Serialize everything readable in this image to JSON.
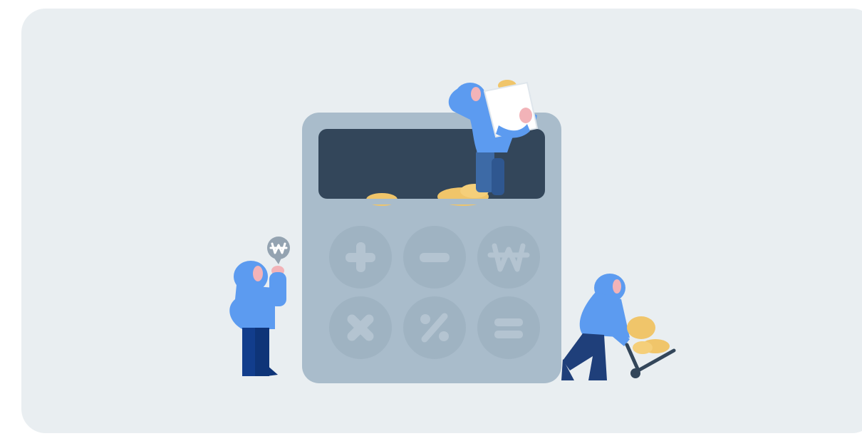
{
  "illustration": {
    "subject": "calculator",
    "keys": [
      {
        "symbol": "+",
        "icon": "plus-icon"
      },
      {
        "symbol": "−",
        "icon": "minus-icon"
      },
      {
        "symbol": "₩",
        "icon": "won-icon"
      },
      {
        "symbol": "×",
        "icon": "times-icon"
      },
      {
        "symbol": "%",
        "icon": "percent-icon"
      },
      {
        "symbol": "=",
        "icon": "equals-icon"
      }
    ],
    "speech_bubble_icon": "won-icon",
    "colors": {
      "card_background": "#e9eef1",
      "calculator_body": "#a9bccb",
      "calculator_screen": "#33465a",
      "key": "#9fb3c2",
      "key_symbol": "#b4c4d1",
      "hoodie": "#5c9bf0",
      "pants": "#123d8c",
      "skin": "#f2b3b8",
      "coin": "#f0c56a"
    }
  }
}
